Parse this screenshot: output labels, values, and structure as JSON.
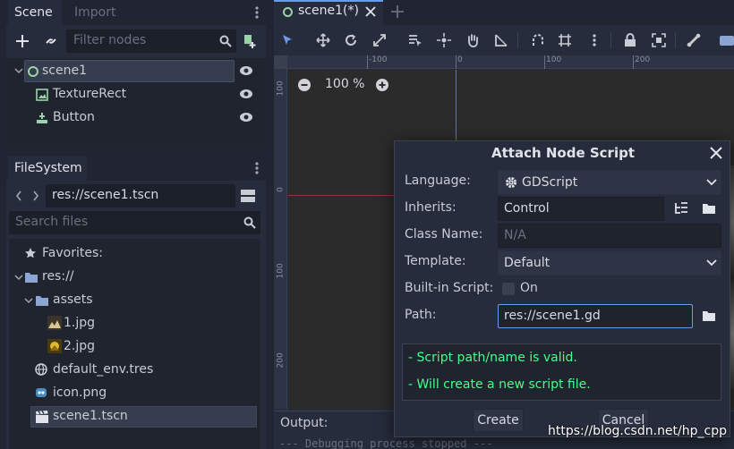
{
  "scene_dock": {
    "tabs": [
      "Scene",
      "Import"
    ],
    "filter_placeholder": "Filter nodes",
    "nodes": [
      "scene1",
      "TextureRect",
      "Button"
    ]
  },
  "filesystem": {
    "tab": "FileSystem",
    "path": "res://scene1.tscn",
    "search_placeholder": "Search files",
    "items": {
      "favorites": "Favorites:",
      "root": "res://",
      "assets": "assets",
      "jpg1": "1.jpg",
      "jpg2": "2.jpg",
      "env": "default_env.tres",
      "icon": "icon.png",
      "scene": "scene1.tscn"
    }
  },
  "editor": {
    "tab_label": "scene1(*)",
    "zoom_label": "100 %",
    "ruler_top": [
      "-100",
      "0",
      "100",
      "200"
    ],
    "ruler_left": [
      "100",
      "0",
      "100",
      "200"
    ],
    "output_label": "Output:",
    "output_text": "--- Debugging process stopped ---"
  },
  "dialog": {
    "title": "Attach Node Script",
    "language_label": "Language:",
    "language_value": "GDScript",
    "inherits_label": "Inherits:",
    "inherits_value": "Control",
    "classname_label": "Class Name:",
    "classname_value": "N/A",
    "template_label": "Template:",
    "template_value": "Default",
    "builtin_label": "Built-in Script:",
    "builtin_toggle": "On",
    "path_label": "Path:",
    "path_value": "res://scene1.gd",
    "status_line1": "- Script path/name is valid.",
    "status_line2": "- Will create a new script file.",
    "create_button": "Create",
    "cancel_button": "Cancel"
  },
  "watermark": "https://blog.csdn.net/hp_cpp",
  "colors": {
    "accent": "#699ce8",
    "valid_green": "#45ff8b",
    "selection_border": "#6a9ce8"
  }
}
